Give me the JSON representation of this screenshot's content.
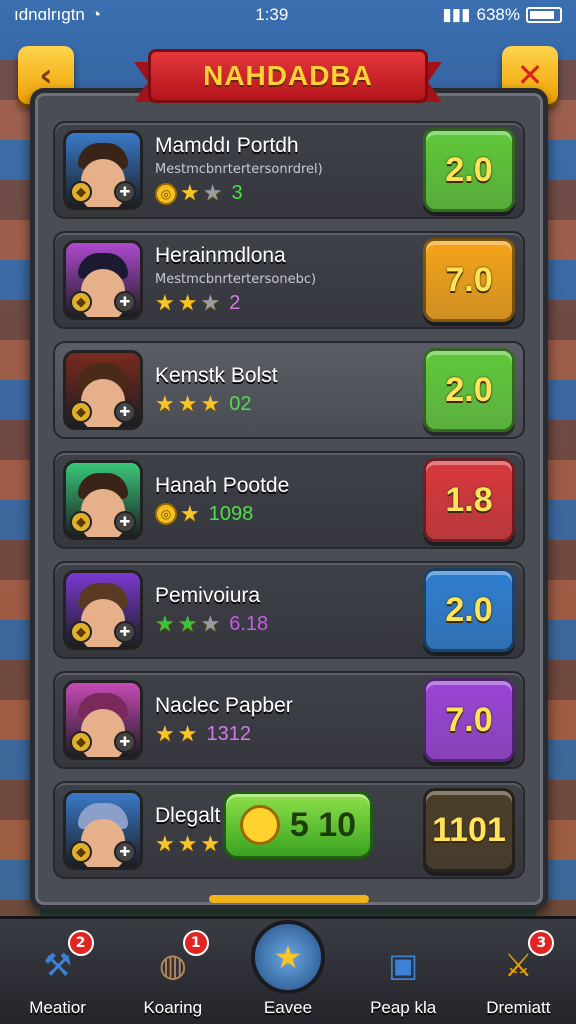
{
  "status_bar": {
    "carrier": "ıdnɑlrıgtn",
    "time": "1:39",
    "battery": "638%"
  },
  "header": {
    "title": "NAHDADBA"
  },
  "colors": {
    "green": "#5fc83a",
    "orange": "#f5a41a",
    "red": "#d8383c",
    "blue": "#2f7fd0",
    "purple": "#9b45d6",
    "dark": "#4a3d2a"
  },
  "cards": [
    {
      "name": "Mamddı Portdh",
      "sub": "Mestmcbnrtertersonrdrel)",
      "stars_icons": [
        "coin-icon",
        "star-icon",
        "grey-star-icon"
      ],
      "score": "3",
      "value": "2.0",
      "value_color": "green",
      "frame": "#3a7ac8",
      "hair": "#3a2418"
    },
    {
      "name": "Herainmdlona",
      "sub": "Mestmcbnrtertersonebc)",
      "stars_icons": [
        "star-icon",
        "star-icon",
        "grey-star-icon"
      ],
      "score": "2",
      "value": "7.0",
      "value_color": "orange",
      "frame": "#b04ad0",
      "hair": "#1c1a30"
    },
    {
      "name": "Kemstk Bolst",
      "sub": "",
      "stars_icons": [
        "star-icon",
        "star-icon",
        "star-icon"
      ],
      "score": "02",
      "value": "2.0",
      "value_color": "green",
      "frame": "#7a2a1e",
      "hair": "#4a2a18"
    },
    {
      "name": "Hanah Pootde",
      "sub": "",
      "stars_icons": [
        "coin-icon",
        "star-icon"
      ],
      "score": "1098",
      "value": "1.8",
      "value_color": "red",
      "frame": "#3ac87a",
      "hair": "#3a2418"
    },
    {
      "name": "Pemivoiura",
      "sub": "",
      "stars_icons": [
        "green-star-icon",
        "green-star-icon",
        "grey-star-icon"
      ],
      "score": "6.18",
      "value": "2.0",
      "value_color": "blue",
      "frame": "#7a3ad0",
      "hair": "#5a3a22"
    },
    {
      "name": "Naclec Papber",
      "sub": "",
      "stars_icons": [
        "star-icon",
        "star-icon"
      ],
      "score": "1312",
      "value": "7.0",
      "value_color": "purple",
      "frame": "#c84ab8",
      "hair": "#7a2a5a"
    },
    {
      "name": "Dlegalt",
      "sub": "",
      "stars_icons": [
        "star-icon",
        "star-icon",
        "star-icon"
      ],
      "score": "",
      "value": "1101",
      "value_color": "dark",
      "frame": "#3a7ac8",
      "hair": "#8aa0c8",
      "overlay": "5 10"
    }
  ],
  "bottom_nav": [
    {
      "label": "Meatior",
      "badge": "2",
      "icon": "hammer-icon",
      "color": "#3b82d6"
    },
    {
      "label": "Koaring",
      "badge": "1",
      "icon": "bag-icon",
      "color": "#b98a5a"
    },
    {
      "label": "Eavee",
      "badge": "",
      "icon": "star-icon",
      "color": "#f7c52a"
    },
    {
      "label": "Peap kla",
      "badge": "",
      "icon": "box-icon",
      "color": "#3b82d6"
    },
    {
      "label": "Dremiatt",
      "badge": "3",
      "icon": "sword-icon",
      "color": "#f0a000"
    }
  ]
}
